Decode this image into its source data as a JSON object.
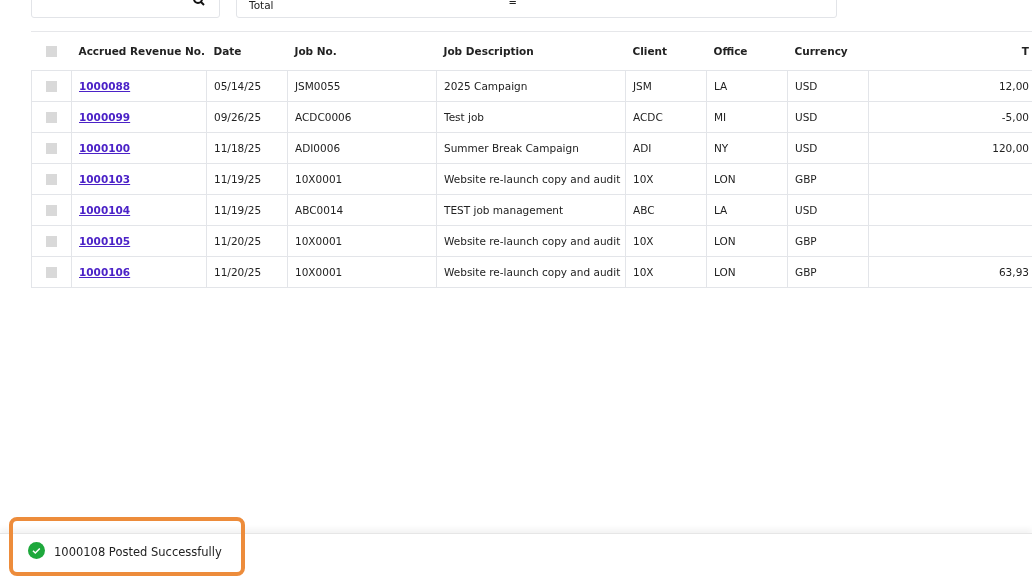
{
  "filters": {
    "total_label": "Total",
    "operator": "="
  },
  "table": {
    "all_selected": false,
    "columns": [
      "Accrued Revenue No.",
      "Date",
      "Job No.",
      "Job Description",
      "Client",
      "Office",
      "Currency",
      "T"
    ],
    "rows": [
      {
        "selected": false,
        "number": "1000088",
        "date": "05/14/25",
        "job": "JSM0055",
        "description": "2025 Campaign",
        "client": "JSM",
        "office": "LA",
        "currency": "USD",
        "total": "12,00"
      },
      {
        "selected": false,
        "number": "1000099",
        "date": "09/26/25",
        "job": "ACDC0006",
        "description": "Test job",
        "client": "ACDC",
        "office": "MI",
        "currency": "USD",
        "total": "-5,00"
      },
      {
        "selected": false,
        "number": "1000100",
        "date": "11/18/25",
        "job": "ADI0006",
        "description": "Summer Break Campaign",
        "client": "ADI",
        "office": "NY",
        "currency": "USD",
        "total": "120,00"
      },
      {
        "selected": false,
        "number": "1000103",
        "date": "11/19/25",
        "job": "10X0001",
        "description": "Website re-launch copy and audit",
        "client": "10X",
        "office": "LON",
        "currency": "GBP"
      },
      {
        "selected": false,
        "number": "1000104",
        "date": "11/19/25",
        "job": "ABC0014",
        "description": "TEST job management",
        "client": "ABC",
        "office": "LA",
        "currency": "USD"
      },
      {
        "selected": false,
        "number": "1000105",
        "date": "11/20/25",
        "job": "10X0001",
        "description": "Website re-launch copy and audit",
        "client": "10X",
        "office": "LON",
        "currency": "GBP"
      },
      {
        "selected": false,
        "number": "1000106",
        "date": "11/20/25",
        "job": "10X0001",
        "description": "Website re-launch copy and audit",
        "client": "10X",
        "office": "LON",
        "currency": "GBP",
        "total": "63,93"
      }
    ]
  },
  "toast": {
    "kind": "success",
    "message": "1000108 Posted Successfully",
    "highlighted": true
  }
}
